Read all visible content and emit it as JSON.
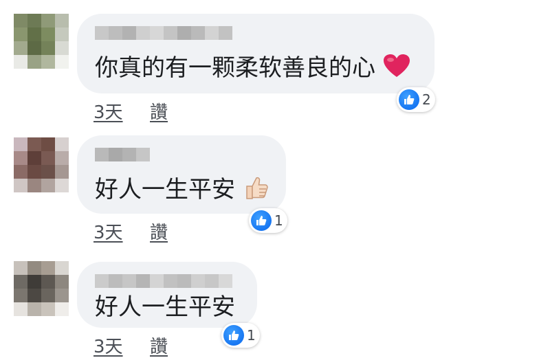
{
  "comments": [
    {
      "text": "你真的有一颗柔软善良的心",
      "emoji": "red-heart",
      "reaction_count": "2",
      "time": "3天",
      "like_label": "讚"
    },
    {
      "text": "好人一生平安",
      "emoji": "thumbs-up",
      "reaction_count": "1",
      "time": "3天",
      "like_label": "讚"
    },
    {
      "text": "好人一生平安",
      "emoji": "",
      "reaction_count": "1",
      "time": "3天",
      "like_label": "讚"
    }
  ],
  "colors": {
    "bubble": "#f0f2f5",
    "like_blue": "#1877f2",
    "heart_red": "#e0245e"
  },
  "avatar_palettes": [
    [
      "#7f8a66",
      "#6d7a55",
      "#8f9a78",
      "#b8bdad",
      "#8a966f",
      "#627048",
      "#7d8c60",
      "#c5c9bd",
      "#a2aa8e",
      "#5d6a45",
      "#748259",
      "#d8dad3",
      "#e9eae6",
      "#99a285",
      "#b0b79e",
      "#f1f2ee"
    ],
    [
      "#c9b7bd",
      "#7b5a52",
      "#6e4d44",
      "#d7d0cf",
      "#a88a88",
      "#5e3f39",
      "#7a5a53",
      "#b9aca9",
      "#8b6b66",
      "#6a4a43",
      "#6b5049",
      "#a59792",
      "#cfc6c4",
      "#9a8680",
      "#b1a49f",
      "#ddd8d6"
    ],
    [
      "#c7c1bb",
      "#938b81",
      "#a79d92",
      "#d9d6d1",
      "#6e6a64",
      "#3f3c38",
      "#5d5852",
      "#8d877f",
      "#7b766f",
      "#4c4843",
      "#6a655e",
      "#9b958e",
      "#e6e3df",
      "#b9b3ab",
      "#c9c3bb",
      "#efedea"
    ]
  ],
  "name_blur_palette": [
    [
      "#c8c8c8",
      "#bdbdbd",
      "#b2b2b2",
      "#cfcfcf",
      "#d7d7d7",
      "#c4c4c4",
      "#aeaeae",
      "#bababa",
      "#d3d3d3",
      "#c2c2c2"
    ],
    [
      "#b9b9b9",
      "#a9a9a9",
      "#b3b3b3",
      "#c6c6c6"
    ],
    [
      "#cbcbcb",
      "#bcbcbc",
      "#c6c6c6",
      "#b5b5b5",
      "#d4d4d4",
      "#c1c1c1",
      "#bbbbbb",
      "#cfcfcf",
      "#c7c7c7",
      "#d8d8d8"
    ]
  ]
}
